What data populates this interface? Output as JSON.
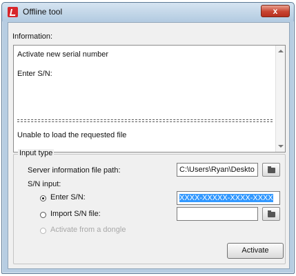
{
  "window": {
    "title": "Offline tool",
    "close_symbol": "x"
  },
  "info": {
    "label": "Information:",
    "lines": [
      "Activate new serial number",
      "Enter S/N:",
      "Unable to load the requested file"
    ],
    "separator": "============================================"
  },
  "input_type": {
    "group_label": "Input type",
    "server_path_label": "Server information file path:",
    "server_path_value": "C:\\Users\\Ryan\\Deskto",
    "sn_input_label": "S/N input:",
    "enter_sn_label": "Enter S/N:",
    "enter_sn_value": "XXXX-XXXXX-XXXX-XXXX",
    "import_sn_label": "Import S/N file:",
    "import_sn_value": "",
    "dongle_label": "Activate from a dongle",
    "selected_option": "Enter S/N:"
  },
  "actions": {
    "activate_label": "Activate"
  },
  "icons": {
    "app": "app-logo-icon",
    "folder": "folder-icon"
  }
}
